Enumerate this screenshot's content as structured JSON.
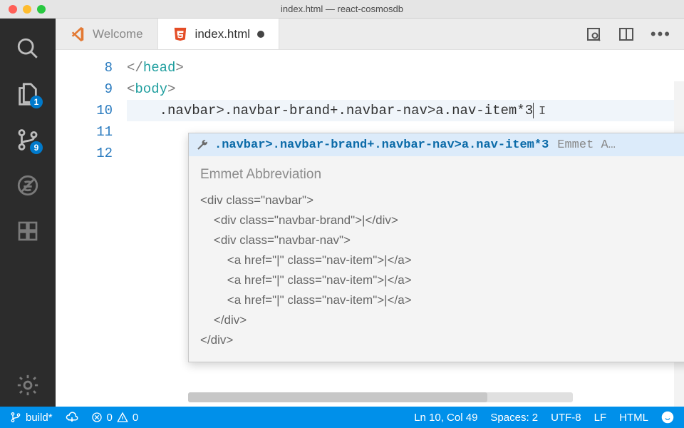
{
  "window": {
    "title": "index.html — react-cosmosdb"
  },
  "activity": {
    "badges": {
      "explorer": "1",
      "scm": "9"
    }
  },
  "tabs": {
    "welcome": "Welcome",
    "file": "index.html"
  },
  "gutter": {
    "l0": "8",
    "l1": "9",
    "l2": "10",
    "l3": "11",
    "l4": "12"
  },
  "code": {
    "line8a": "</",
    "line8b": "head",
    "line8c": ">",
    "line9a": "<",
    "line9b": "body",
    "line9c": ">",
    "line10": "    .navbar>.navbar-brand+.navbar-nav>a.nav-item*3"
  },
  "suggest": {
    "abbr": ".navbar>.navbar-brand+.navbar-nav>a.nav-item*3",
    "kind": "Emmet A…",
    "title": "Emmet Abbreviation",
    "preview": "<div class=\"navbar\">\n    <div class=\"navbar-brand\">|</div>\n    <div class=\"navbar-nav\">\n        <a href=\"|\" class=\"nav-item\">|</a>\n        <a href=\"|\" class=\"nav-item\">|</a>\n        <a href=\"|\" class=\"nav-item\">|</a>\n    </div>\n</div>"
  },
  "status": {
    "branch": "build*",
    "errors": "0",
    "warnings": "0",
    "cursor": "Ln 10, Col 49",
    "spaces": "Spaces: 2",
    "encoding": "UTF-8",
    "eol": "LF",
    "lang": "HTML"
  }
}
